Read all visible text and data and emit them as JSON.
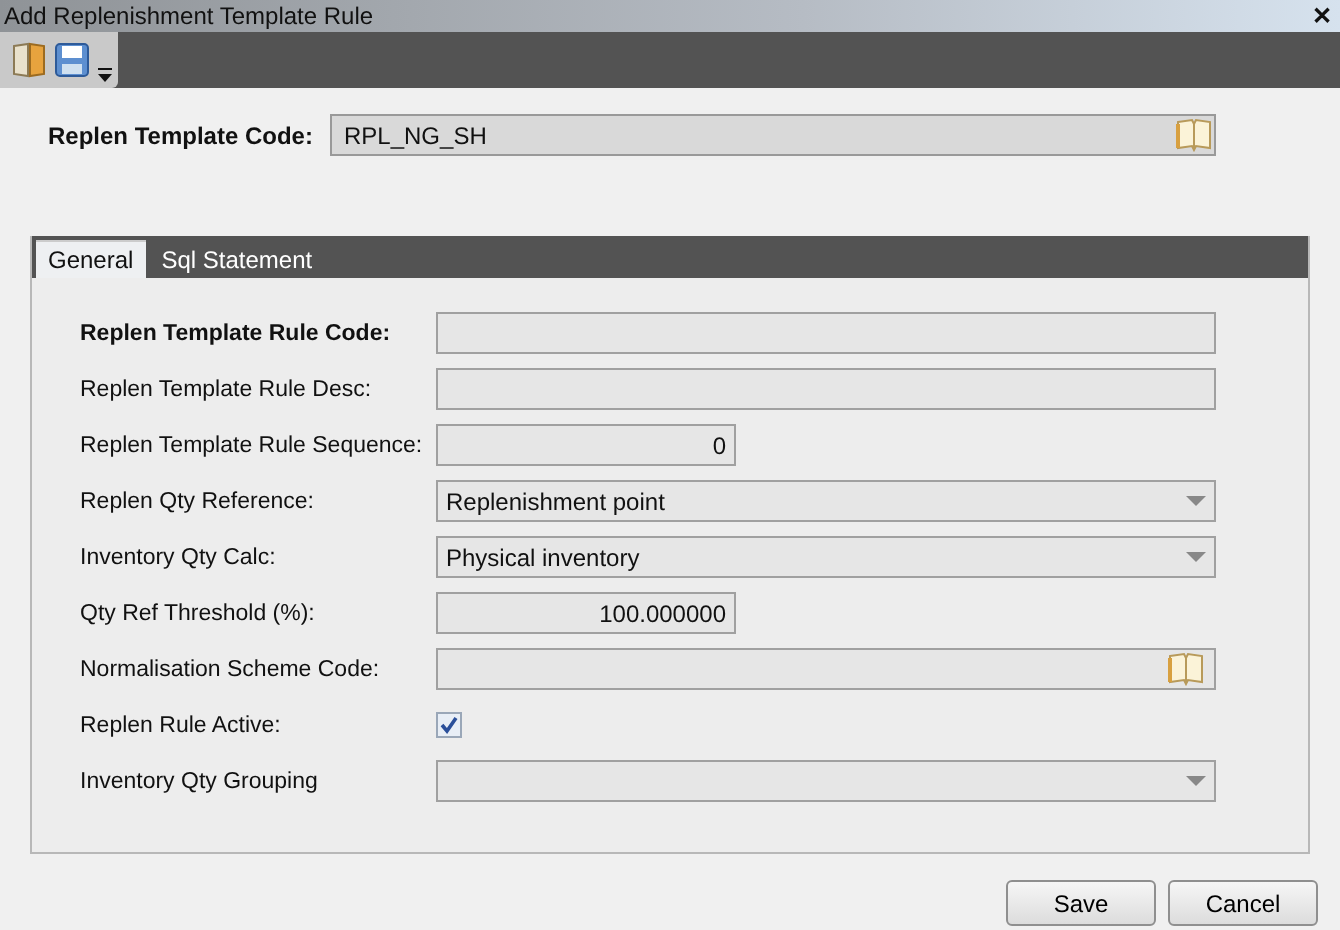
{
  "window": {
    "title": "Add Replenishment Template Rule",
    "close": "✕"
  },
  "header": {
    "label": "Replen Template Code:",
    "value": "RPL_NG_SH"
  },
  "tabs": [
    {
      "label": "General",
      "selected": true
    },
    {
      "label": "Sql Statement",
      "selected": false
    }
  ],
  "fields": [
    {
      "label": "Replen Template Rule Code:",
      "kind": "text",
      "required": true
    },
    {
      "label": "Replen Template Rule Desc:",
      "kind": "text",
      "required": false
    },
    {
      "label": "Replen Template Rule Sequence:",
      "kind": "number",
      "required": false,
      "value": "0"
    },
    {
      "label": "Replen Qty Reference:",
      "kind": "dropdown",
      "required": false,
      "value": "Replenishment point"
    },
    {
      "label": "Inventory Qty Calc:",
      "kind": "dropdown",
      "required": false,
      "value": "Physical inventory"
    },
    {
      "label": "Qty Ref Threshold (%):",
      "kind": "number",
      "required": false,
      "value": "100.000000"
    },
    {
      "label": "Normalisation Scheme Code:",
      "kind": "lookup",
      "required": false
    },
    {
      "label": "Replen Rule Active:",
      "kind": "checkbox",
      "required": false,
      "checked": true
    },
    {
      "label": "Inventory Qty Grouping",
      "kind": "dropdown",
      "required": false
    }
  ],
  "buttons": [
    "Save",
    "Cancel"
  ]
}
